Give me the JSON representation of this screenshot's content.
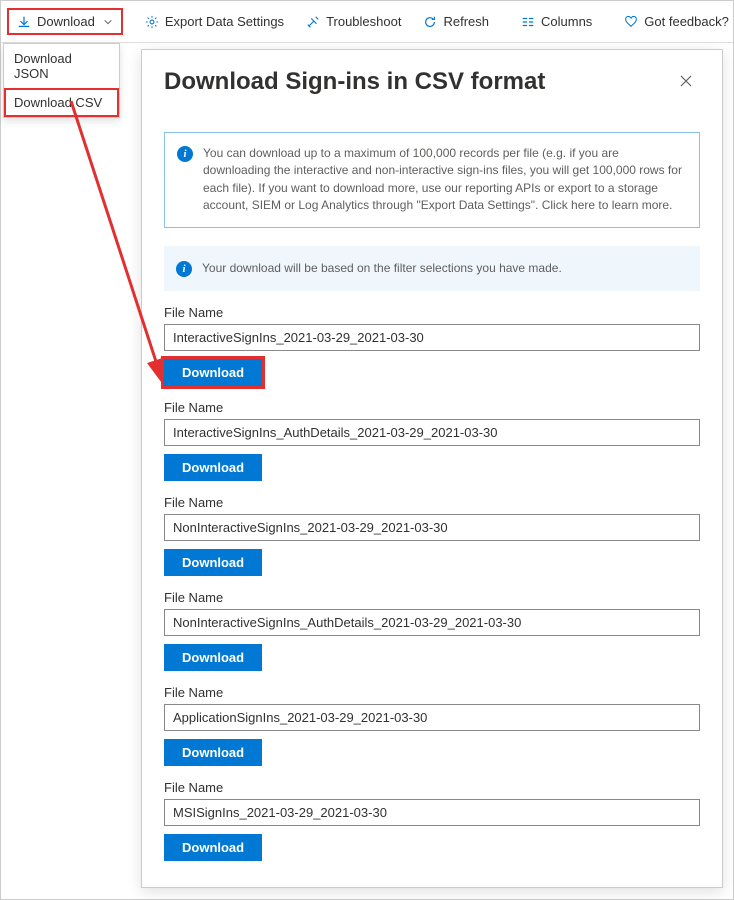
{
  "toolbar": {
    "download": "Download",
    "export": "Export Data Settings",
    "troubleshoot": "Troubleshoot",
    "refresh": "Refresh",
    "columns": "Columns",
    "feedback": "Got feedback?"
  },
  "dropdown": {
    "json": "Download JSON",
    "csv": "Download CSV"
  },
  "panel": {
    "title": "Download Sign-ins in CSV format",
    "info1": "You can download up to a maximum of 100,000 records per file (e.g. if you are downloading the interactive and non-interactive sign-ins files, you will get 100,000 rows for each file).  If you want to download more, use our reporting APIs or export to a storage account, SIEM or Log Analytics through \"Export Data Settings\". Click here to learn more.",
    "info2": "Your download will be based on the filter selections you have made.",
    "fileLabel": "File Name",
    "downloadLabel": "Download",
    "fields": [
      {
        "value": "InteractiveSignIns_2021-03-29_2021-03-30",
        "highlight": true
      },
      {
        "value": "InteractiveSignIns_AuthDetails_2021-03-29_2021-03-30",
        "highlight": false
      },
      {
        "value": "NonInteractiveSignIns_2021-03-29_2021-03-30",
        "highlight": false
      },
      {
        "value": "NonInteractiveSignIns_AuthDetails_2021-03-29_2021-03-30",
        "highlight": false
      },
      {
        "value": "ApplicationSignIns_2021-03-29_2021-03-30",
        "highlight": false
      },
      {
        "value": "MSISignIns_2021-03-29_2021-03-30",
        "highlight": false
      }
    ]
  }
}
